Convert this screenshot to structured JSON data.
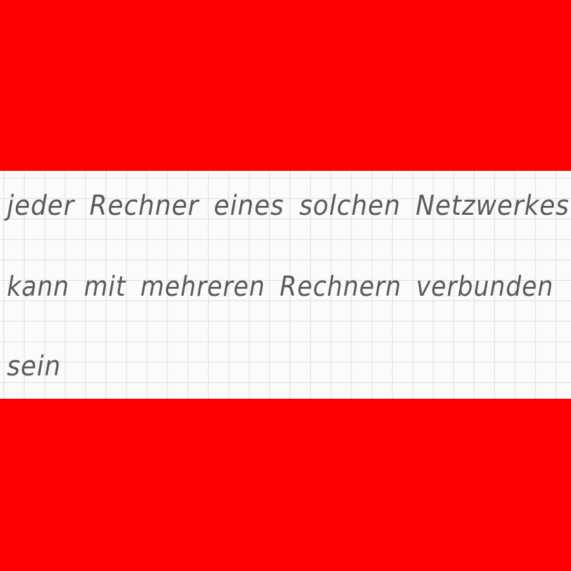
{
  "colors": {
    "band": "#ff0000",
    "paper": "#fbfbfb",
    "grid": "#dedede",
    "ink": "#5a5a5a"
  },
  "handwriting": {
    "lines": [
      "jeder Rechner eines solchen Netzwerkes",
      "kann mit mehreren Rechnern verbunden",
      "sein"
    ]
  }
}
